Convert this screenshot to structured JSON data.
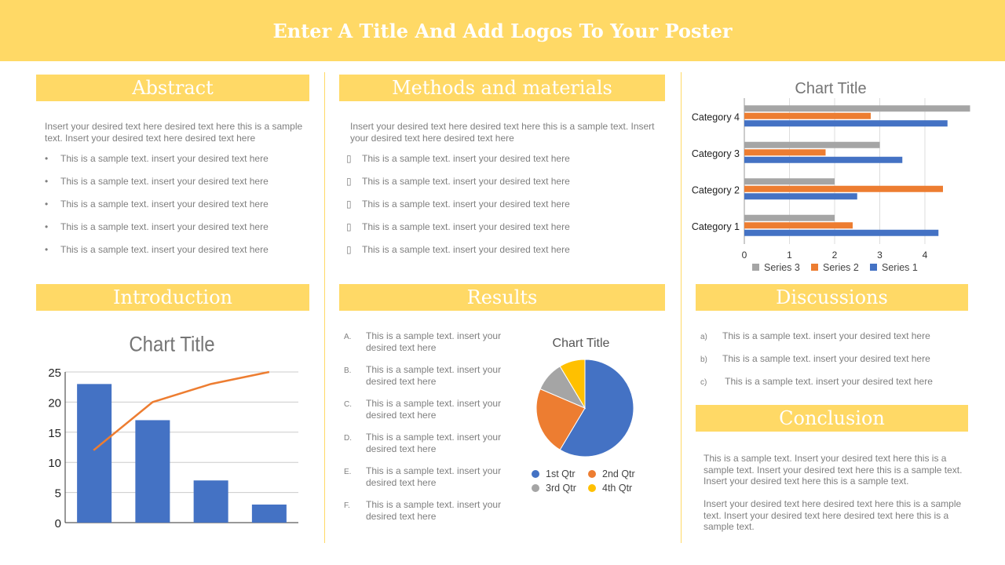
{
  "title": "Enter A Title And Add Logos To Your Poster",
  "colors": {
    "accent": "#FFD966",
    "series_blue": "#4472C4",
    "series_orange": "#ED7D31",
    "series_gray": "#A5A5A5",
    "series_yellow": "#FFC000"
  },
  "abstract": {
    "heading": "Abstract",
    "para": "Insert your desired text here desired text here this is a sample text. Insert your desired text here desired text here",
    "bullet_icon": "bullet-dot",
    "items": [
      "This is a sample text. insert your desired text here",
      "This is a sample text. insert your desired text here",
      "This is a sample text. insert your desired text here",
      "This is a sample text. insert your desired text here",
      "This is a sample text. insert your desired text here"
    ]
  },
  "methods": {
    "heading": "Methods and materials",
    "para": "Insert your desired text here desired text here this is a sample text. Insert your desired text here desired text here",
    "bullet_icon": "missing-glyph-box",
    "items": [
      "This is a sample text. insert your desired text here",
      "This is a sample text. insert your desired text here",
      "This is a sample text. insert your desired text here",
      "This is a sample text. insert your desired text here",
      "This is a sample text. insert your desired text here"
    ]
  },
  "introduction": {
    "heading": "Introduction"
  },
  "results": {
    "heading": "Results",
    "items": [
      {
        "marker": "A.",
        "text": "This is a sample text. insert your desired text here"
      },
      {
        "marker": "B.",
        "text": "This is a sample text. insert your desired text here"
      },
      {
        "marker": "C.",
        "text": "This is a sample text. insert your desired text here"
      },
      {
        "marker": "D.",
        "text": "This is a sample text. insert your desired text here"
      },
      {
        "marker": "E.",
        "text": "This is a sample text. insert your desired text here"
      },
      {
        "marker": "F.",
        "text": "This is a sample text. insert your desired text here"
      }
    ]
  },
  "discussions": {
    "heading": "Discussions",
    "items": [
      {
        "marker": "a)",
        "text": "This is a sample text. insert your desired text here"
      },
      {
        "marker": "b)",
        "text": "This is a sample text. insert your desired text here"
      },
      {
        "marker": "c)",
        "text": " This is a sample text. insert your desired text here"
      }
    ]
  },
  "conclusion": {
    "heading": "Conclusion",
    "paras": [
      "This is a sample text. Insert your desired text here this is a sample text. Insert your desired text here this is a sample text. Insert your desired text here this is a sample text.",
      "Insert your desired text here desired text here this is a sample text. Insert your desired text here desired text here this is a sample text."
    ]
  },
  "chart_data": [
    {
      "type": "bar",
      "orientation": "horizontal",
      "title": "Chart Title",
      "categories": [
        "Category 1",
        "Category 2",
        "Category 3",
        "Category 4"
      ],
      "series": [
        {
          "name": "Series 1",
          "values": [
            4.3,
            2.5,
            3.5,
            4.5
          ]
        },
        {
          "name": "Series 2",
          "values": [
            2.4,
            4.4,
            1.8,
            2.8
          ]
        },
        {
          "name": "Series 3",
          "values": [
            2,
            2,
            3,
            5
          ]
        }
      ],
      "xlim": [
        0,
        5
      ],
      "xticks": [
        0,
        1,
        2,
        3,
        4
      ],
      "grid": true,
      "legend": "bottom"
    },
    {
      "type": "bar+line",
      "title": "Chart Title",
      "bars": [
        23,
        17,
        7,
        3
      ],
      "line": [
        12,
        20,
        23,
        25
      ],
      "ylim": [
        0,
        25
      ],
      "yticks": [
        0,
        5,
        10,
        15,
        20,
        25
      ],
      "grid": true
    },
    {
      "type": "pie",
      "title": "Chart Title",
      "labels": [
        "1st Qtr",
        "2nd Qtr",
        "3rd Qtr",
        "4th Qtr"
      ],
      "values": [
        8.2,
        3.2,
        1.4,
        1.2
      ],
      "legend": "bottom"
    }
  ]
}
